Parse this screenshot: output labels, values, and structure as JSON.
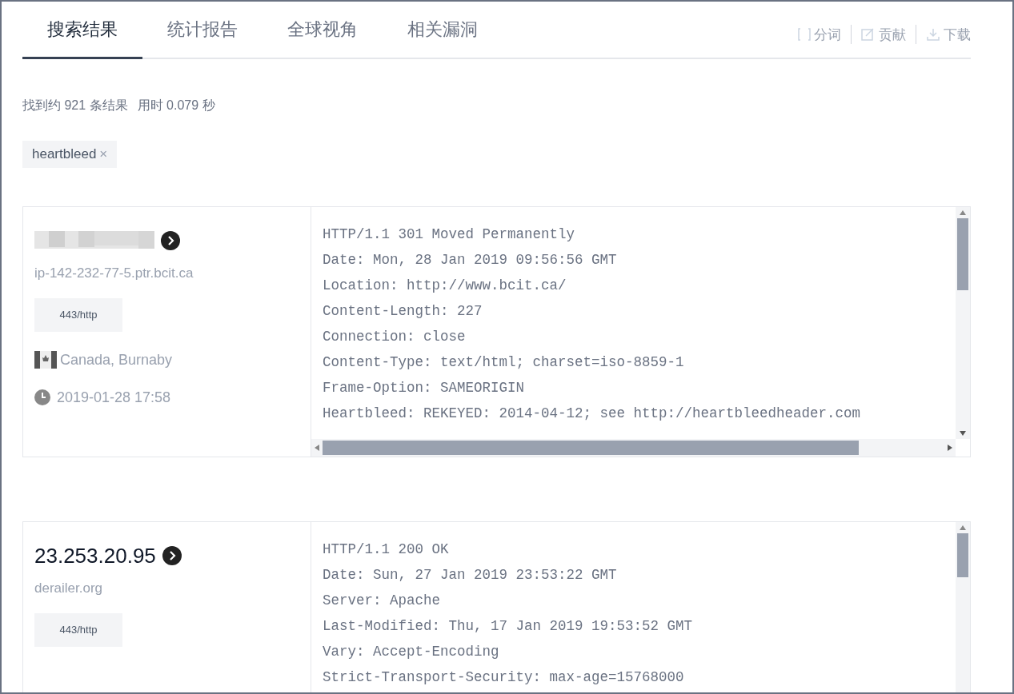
{
  "tabs": [
    {
      "label": "搜索结果",
      "selected": true
    },
    {
      "label": "统计报告",
      "selected": false
    },
    {
      "label": "全球视角",
      "selected": false
    },
    {
      "label": "相关漏洞",
      "selected": false
    }
  ],
  "toolbar": [
    {
      "kind": "segment",
      "label": "分词"
    },
    {
      "kind": "contribute",
      "label": "贡献"
    },
    {
      "kind": "download",
      "label": "下载"
    }
  ],
  "summary": {
    "count": "找到约 921 条结果",
    "time": "用时 0.079 秒"
  },
  "filters": [
    {
      "label": "heartbleed",
      "remove": "×"
    }
  ],
  "results": [
    {
      "ip_hidden": true,
      "hostname": "ip-142-232-77-5.ptr.bcit.ca",
      "port": "443/http",
      "location": "Canada, Burnaby",
      "time": "2019-01-28 17:58",
      "horizontal_scrollbar": true,
      "banner": [
        "HTTP/1.1 301 Moved Permanently",
        "Date: Mon, 28 Jan 2019 09:56:56 GMT",
        "Location: http://www.bcit.ca/",
        "Content-Length: 227",
        "Connection: close",
        "Content-Type: text/html; charset=iso-8859-1",
        "Frame-Option: SAMEORIGIN",
        "Heartbleed: REKEYED: 2014-04-12; see http://heartbleedheader.com"
      ]
    },
    {
      "ip_hidden": false,
      "ip": "23.253.20.95",
      "hostname": "derailer.org",
      "port": "443/http",
      "horizontal_scrollbar": false,
      "banner": [
        "HTTP/1.1 200 OK",
        "Date: Sun, 27 Jan 2019 23:53:22 GMT",
        "Server: Apache",
        "Last-Modified: Thu, 17 Jan 2019 19:53:52 GMT",
        "Vary: Accept-Encoding",
        "Strict-Transport-Security: max-age=15768000"
      ]
    }
  ]
}
